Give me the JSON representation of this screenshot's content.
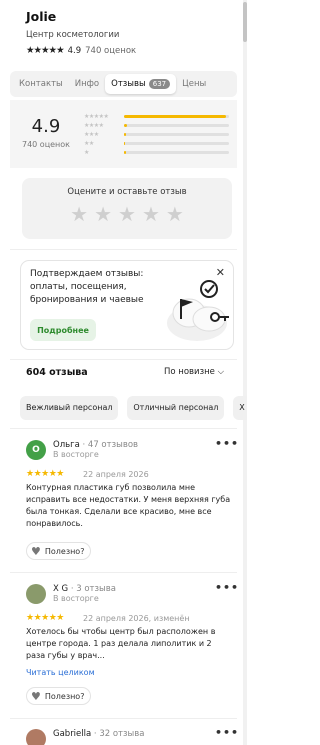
{
  "header": {
    "title": "Jolie",
    "subtitle": "Центр косметологии",
    "stars": "★★★★★",
    "rating": "4.9",
    "ratings_count": "740 оценок"
  },
  "tabs": [
    {
      "label": "Контакты",
      "active": false
    },
    {
      "label": "Инфо",
      "active": false
    },
    {
      "label": "Отзывы",
      "active": true,
      "badge": "637"
    },
    {
      "label": "Цены",
      "active": false
    }
  ],
  "summary": {
    "rating": "4.9",
    "count": "740 оценок",
    "distribution": [
      {
        "stars": "★★★★★",
        "fraction": 0.97
      },
      {
        "stars": "★★★★",
        "fraction": 0.03
      },
      {
        "stars": "★★★",
        "fraction": 0.02
      },
      {
        "stars": "★★",
        "fraction": 0.01
      },
      {
        "stars": "★",
        "fraction": 0.02
      }
    ]
  },
  "rate_box": {
    "title": "Оцените и оставьте отзыв",
    "stars": [
      "★",
      "★",
      "★",
      "★",
      "★"
    ]
  },
  "promo": {
    "text": "Подтверждаем отзывы: оплаты, посещения, бронирования и чаевые",
    "button": "Подробнее",
    "close": "✕"
  },
  "list": {
    "count": "604 отзыва",
    "sort": "По новизне ⌵"
  },
  "chips": [
    "Вежливый персонал",
    "Отличный персонал",
    "Х"
  ],
  "reviews": [
    {
      "avatar": "О",
      "avatar_color": "#43a047",
      "name": "Ольга",
      "meta": " · 47 отзывов",
      "status": "В восторге",
      "stars": "★★★★★",
      "date": "22 апреля 2026",
      "text": "Контурная пластика губ позволила мне исправить все недостатки. У меня верхняя губа была тонкая. Сделали все красиво, мне все понравилось.",
      "link": "",
      "helpful": "Полезно?",
      "menu": "•••"
    },
    {
      "avatar": "",
      "avatar_color": "#8a9a6b",
      "name": "X G",
      "meta": " · 3 отзыва",
      "status": "В восторге",
      "stars": "★★★★★",
      "date": "22 апреля 2026, изменён",
      "text": "Хотелось бы чтобы центр был расположен в центре города. 1 раз делала липолитик и 2 раза губы у врач...",
      "link": "Читать целиком",
      "helpful": "Полезно?",
      "menu": "•••"
    },
    {
      "avatar": "",
      "avatar_color": "#b07a63",
      "name": "Gabriella",
      "meta": " · 32 отзыва",
      "status": "",
      "stars": "",
      "date": "",
      "text": "",
      "link": "",
      "helpful": "",
      "menu": "•••"
    }
  ],
  "colors": {
    "star_gold": "#f5b800",
    "promo_green": "#2e8b2e",
    "link_blue": "#2b6fd6"
  }
}
